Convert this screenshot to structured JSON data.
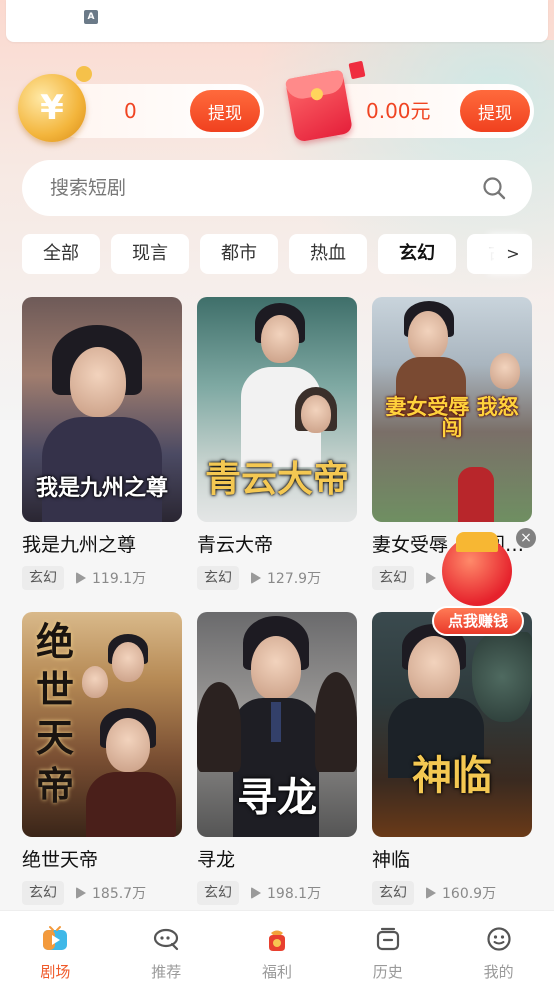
{
  "topbar": {
    "app_badge": "A"
  },
  "rewards": {
    "coins_value": "0",
    "coins_action": "提现",
    "cash_value": "0.00元",
    "cash_action": "提现"
  },
  "search": {
    "placeholder": "搜索短剧"
  },
  "categories": {
    "tabs": [
      "全部",
      "现言",
      "都市",
      "热血",
      "玄幻",
      "古"
    ],
    "active": "玄幻",
    "more_icon": "chevron-right-icon"
  },
  "dramas": [
    {
      "title": "我是九州之尊",
      "poster_text": "我是九州之尊",
      "genre": "玄幻",
      "views": "119.1万"
    },
    {
      "title": "青云大帝",
      "poster_text": "青云大帝",
      "genre": "玄幻",
      "views": "127.9万"
    },
    {
      "title": "妻女受辱，怒闯…",
      "poster_text": "妻女受辱 我怒闯",
      "genre": "玄幻",
      "views": ""
    },
    {
      "title": "绝世天帝",
      "poster_text": "绝世天帝",
      "genre": "玄幻",
      "views": "185.7万"
    },
    {
      "title": "寻龙",
      "poster_text": "寻龙",
      "genre": "玄幻",
      "views": "198.1万"
    },
    {
      "title": "神临",
      "poster_text": "神临",
      "genre": "玄幻",
      "views": "160.9万"
    }
  ],
  "promo": {
    "label": "点我赚钱",
    "close": "×"
  },
  "bottom_nav": [
    {
      "label": "剧场",
      "icon": "tv-icon",
      "active": true
    },
    {
      "label": "推荐",
      "icon": "chat-bubble-icon",
      "active": false
    },
    {
      "label": "福利",
      "icon": "lucky-bag-icon",
      "active": false
    },
    {
      "label": "历史",
      "icon": "history-icon",
      "active": false
    },
    {
      "label": "我的",
      "icon": "smiley-icon",
      "active": false
    }
  ],
  "colors": {
    "accent": "#f04422",
    "nav_active": "#f05a2a"
  }
}
